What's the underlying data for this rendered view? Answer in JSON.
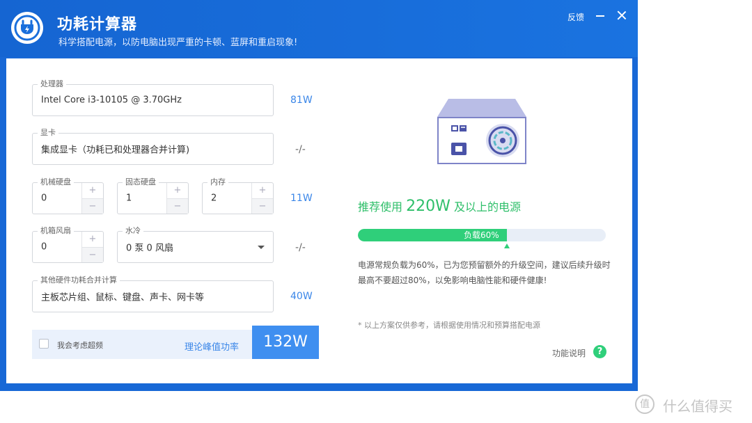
{
  "app": {
    "title": "功耗计算器",
    "subtitle": "科学搭配电源，以防电脑出现严重的卡顿、蓝屏和重启现象!",
    "feedback": "反馈",
    "accent": "#1868d6"
  },
  "form": {
    "cpu": {
      "label": "处理器",
      "value": "Intel Core i3-10105 @ 3.70GHz",
      "watt": "81W"
    },
    "gpu": {
      "label": "显卡",
      "value": "集成显卡（功耗已和处理器合并计算)",
      "watt": "-/-"
    },
    "storage_row": {
      "hdd": {
        "label": "机械硬盘",
        "value": "0"
      },
      "ssd": {
        "label": "固态硬盘",
        "value": "1"
      },
      "ram": {
        "label": "内存",
        "value": "2"
      },
      "watt": "11W"
    },
    "cooling_row": {
      "fan": {
        "label": "机箱风扇",
        "value": "0"
      },
      "water": {
        "label": "水冷",
        "value": "0 泵 0 风扇"
      },
      "watt": "-/-"
    },
    "other": {
      "label": "其他硬件功耗合并计算",
      "value": "主板芯片组、鼠标、键盘、声卡、网卡等",
      "watt": "40W"
    },
    "stepper": {
      "plus": "+",
      "minus": "−"
    }
  },
  "summary": {
    "overclock_label": "我会考虑超频",
    "peak_label": "理论峰值功率",
    "total": "132W"
  },
  "recommendation": {
    "prefix": "推荐使用",
    "watt": "220W",
    "suffix": "及以上的电源",
    "load_label": "负载60%",
    "load_fraction": 0.6,
    "description": "电源常规负载为60%，已为您预留额外的升级空间，建议后续升级时最高不要超过80%，以免影响电脑性能和硬件健康!",
    "note": "* 以上方案仅供参考，请根据使用情况和预算搭配电源",
    "help_label": "功能说明",
    "help_icon": "?"
  },
  "watermark": {
    "text": "什么值得买",
    "icon": "值"
  }
}
